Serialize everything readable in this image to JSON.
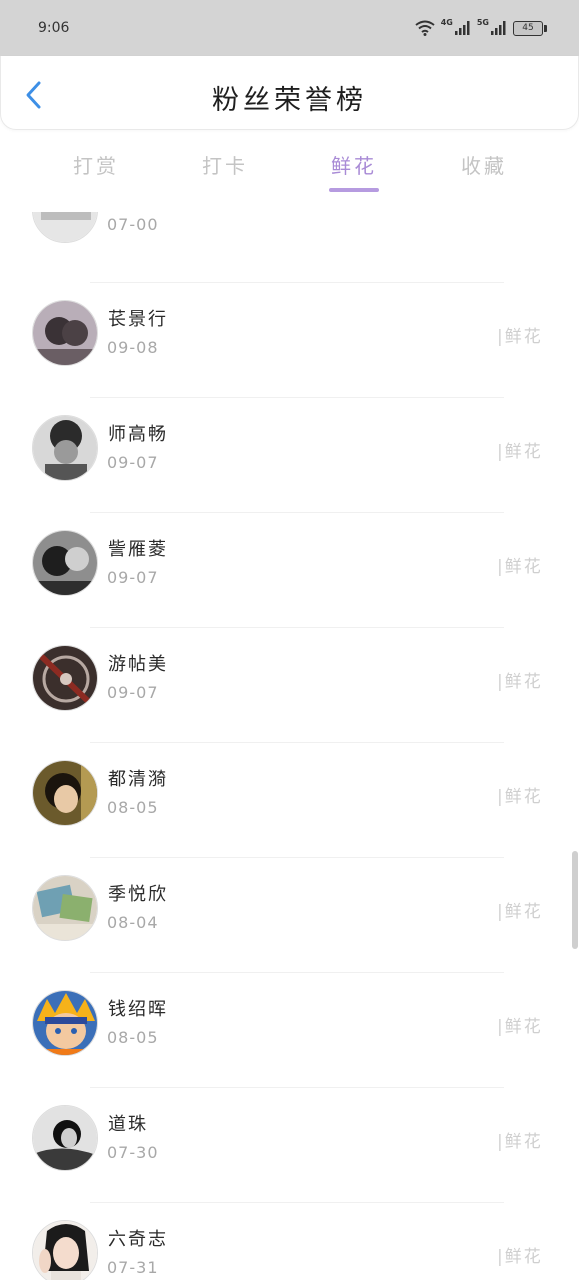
{
  "status_bar": {
    "time": "9:06",
    "network_1": "4G",
    "network_2": "5G",
    "battery": "45"
  },
  "header": {
    "back_icon": "chevron-left-icon",
    "title": "粉丝荣誉榜",
    "accent_color": "#3d8fe6"
  },
  "tabs": [
    {
      "label": "打赏"
    },
    {
      "label": "打卡"
    },
    {
      "label": "鲜花"
    },
    {
      "label": "收藏"
    }
  ],
  "active_tab": "鲜花",
  "accent_color": "#a98bd6",
  "list": {
    "partial_top": {
      "date": "07-00"
    },
    "items": [
      {
        "name": "苌景行",
        "date": "09-08",
        "gift": "|鲜花"
      },
      {
        "name": "师高畅",
        "date": "09-07",
        "gift": "|鲜花"
      },
      {
        "name": "訾雁菱",
        "date": "09-07",
        "gift": "|鲜花"
      },
      {
        "name": "游帖美",
        "date": "09-07",
        "gift": "|鲜花"
      },
      {
        "name": "都清漪",
        "date": "08-05",
        "gift": "|鲜花"
      },
      {
        "name": "季悦欣",
        "date": "08-04",
        "gift": "|鲜花"
      },
      {
        "name": "钱绍晖",
        "date": "08-05",
        "gift": "|鲜花"
      },
      {
        "name": "道珠",
        "date": "07-30",
        "gift": "|鲜花"
      },
      {
        "name": "六奇志",
        "date": "07-31",
        "gift": "|鲜花"
      }
    ]
  }
}
